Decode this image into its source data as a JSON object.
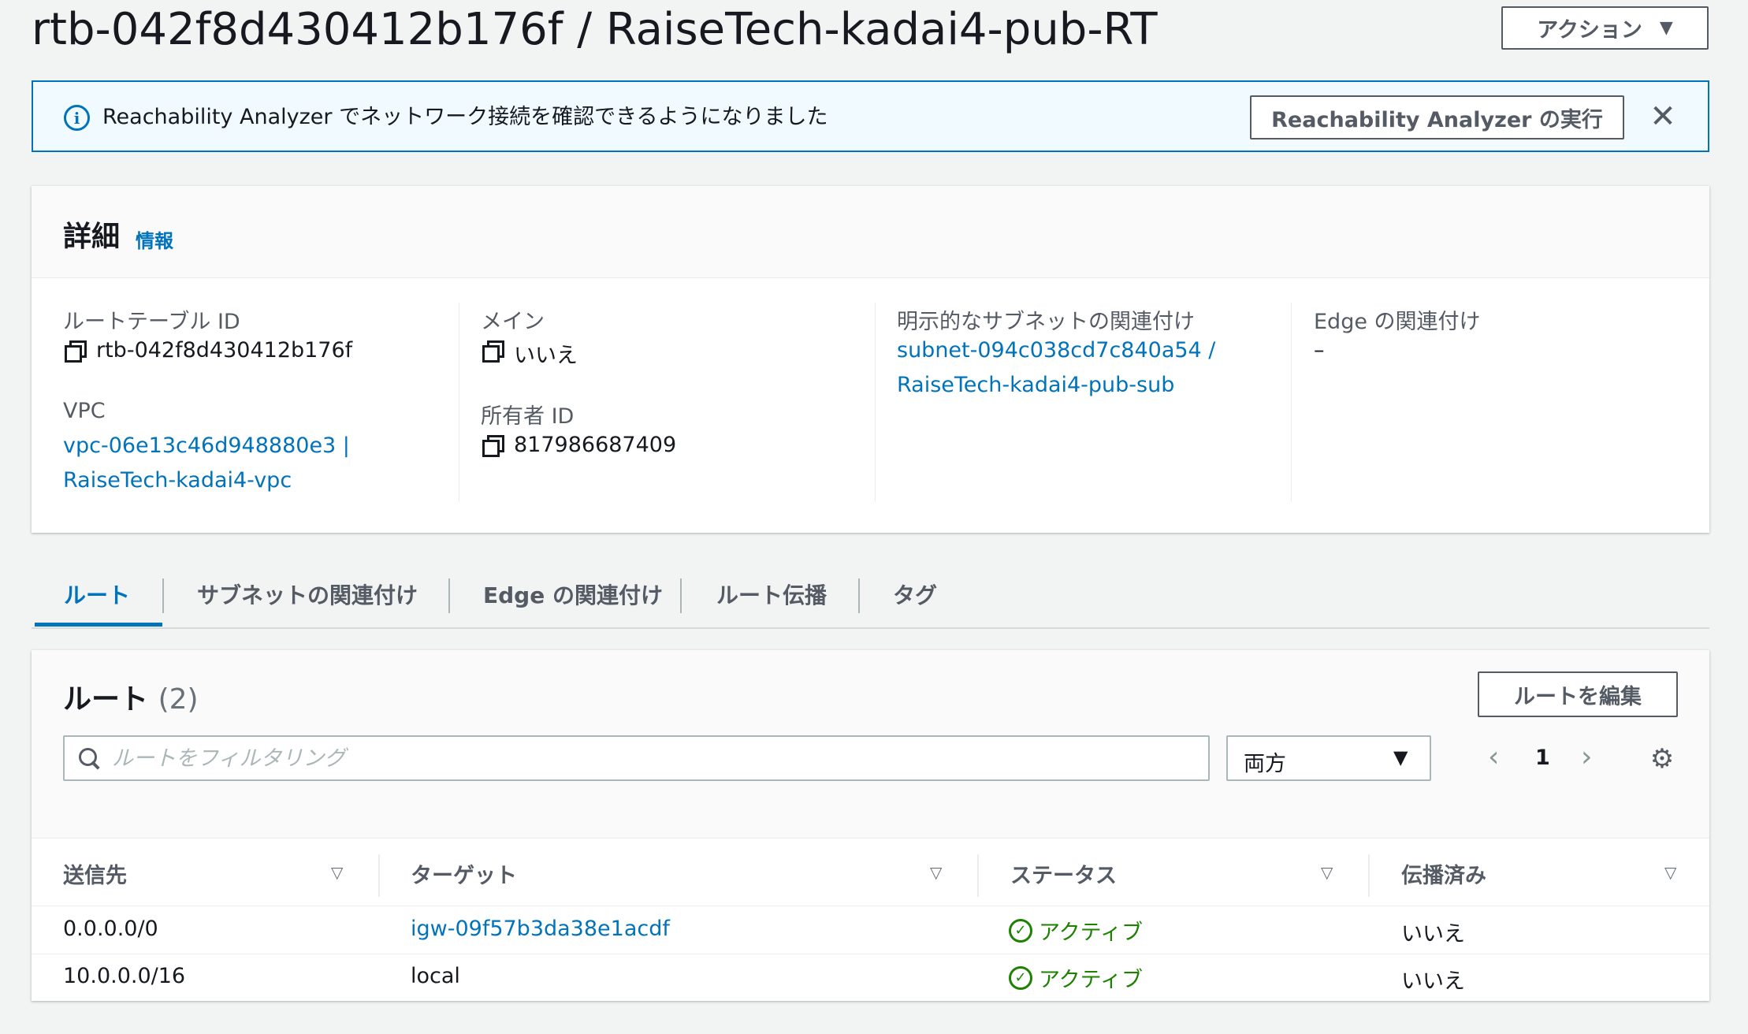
{
  "header": {
    "title": "rtb-042f8d430412b176f / RaiseTech-kadai4-pub-RT",
    "action_label": "アクション",
    "action_caret": "▼"
  },
  "banner": {
    "icon": "info-icon",
    "text": "Reachability Analyzer でネットワーク接続を確認できるようになりました",
    "button_label": "Reachability Analyzer の実行",
    "close_glyph": "✕",
    "border_color": "#0073bb"
  },
  "details": {
    "title": "詳細",
    "info_link": "情報",
    "route_table_id_label": "ルートテーブル ID",
    "route_table_id": "rtb-042f8d430412b176f",
    "vpc_label": "VPC",
    "vpc_line1": "vpc-06e13c46d948880e3 |",
    "vpc_line2": "RaiseTech-kadai4-vpc",
    "main_label": "メイン",
    "main_value": "いいえ",
    "owner_label": "所有者 ID",
    "owner_value": "817986687409",
    "subnet_assoc_label": "明示的なサブネットの関連付け",
    "subnet_line1": "subnet-094c038cd7c840a54 /",
    "subnet_line2": "RaiseTech-kadai4-pub-sub",
    "edge_assoc_label": "Edge の関連付け",
    "edge_assoc_value": "–"
  },
  "tabs": [
    {
      "label": "ルート",
      "active": true
    },
    {
      "label": "サブネットの関連付け",
      "active": false
    },
    {
      "label": "Edge の関連付け",
      "active": false
    },
    {
      "label": "ルート伝播",
      "active": false
    },
    {
      "label": "タグ",
      "active": false
    }
  ],
  "routes": {
    "title": "ルート",
    "count": "(2)",
    "edit_button": "ルートを編集",
    "search_placeholder": "ルートをフィルタリング",
    "filter_value": "両方",
    "filter_caret": "▼",
    "page": "1",
    "prev_glyph": "‹",
    "next_glyph": "›",
    "gear_glyph": "⚙",
    "sort_glyph": "▽",
    "columns": [
      "送信先",
      "ターゲット",
      "ステータス",
      "伝播済み"
    ],
    "rows": [
      {
        "destination": "0.0.0.0/0",
        "target": "igw-09f57b3da38e1acdf",
        "target_is_link": true,
        "status": "アクティブ",
        "propagated": "いいえ"
      },
      {
        "destination": "10.0.0.0/16",
        "target": "local",
        "target_is_link": false,
        "status": "アクティブ",
        "propagated": "いいえ"
      }
    ],
    "status_color": "#1d8102",
    "link_color": "#0073bb"
  }
}
